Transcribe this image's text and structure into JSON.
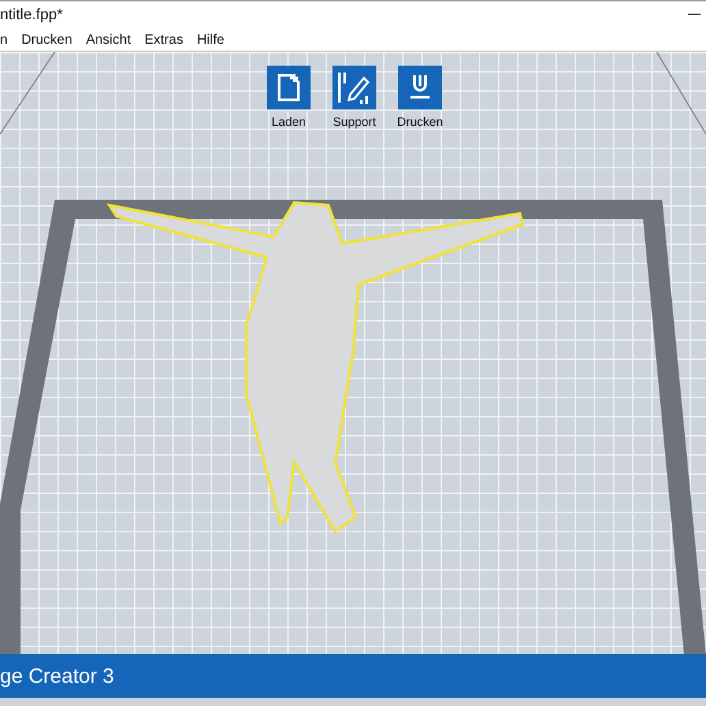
{
  "window": {
    "title": "ntitle.fpp*"
  },
  "menu": [
    "n",
    "Drucken",
    "Ansicht",
    "Extras",
    "Hilfe"
  ],
  "toolbar": [
    {
      "kind": "load",
      "label": "Laden"
    },
    {
      "kind": "support",
      "label": "Support"
    },
    {
      "kind": "print",
      "label": "Drucken"
    }
  ],
  "status_bar": {
    "text": "ge Creator 3"
  }
}
